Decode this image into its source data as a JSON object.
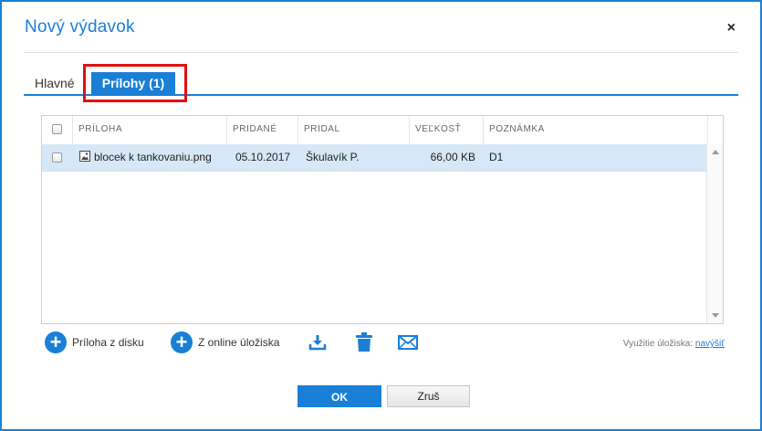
{
  "dialog": {
    "title": "Nový výdavok",
    "close_glyph": "×"
  },
  "tabs": [
    {
      "label": "Hlavné",
      "active": false
    },
    {
      "label": "Prílohy (1)",
      "active": true
    }
  ],
  "table": {
    "columns": [
      "PRÍLOHA",
      "PRIDANÉ",
      "PRIDAL",
      "VEĽKOSŤ",
      "POZNÁMKA"
    ],
    "rows": [
      {
        "filename": "blocek k tankovaniu.png",
        "added": "05.10.2017",
        "added_by": "Škulavík P.",
        "size": "66,00 KB",
        "note": "D1",
        "selected": true
      }
    ]
  },
  "toolbar": {
    "add_from_disk": "Príloha z disku",
    "add_from_online": "Z online úložiska",
    "download_icon": "download-icon",
    "delete_icon": "trash-icon",
    "email_icon": "envelope-icon",
    "usage_label": "Využitie úložiska:",
    "usage_link": "navýšiť"
  },
  "buttons": {
    "ok": "OK",
    "cancel": "Zruš"
  },
  "colors": {
    "accent": "#1a7fd6",
    "highlight": "#e01010",
    "selected_row": "#d6e8f7"
  }
}
